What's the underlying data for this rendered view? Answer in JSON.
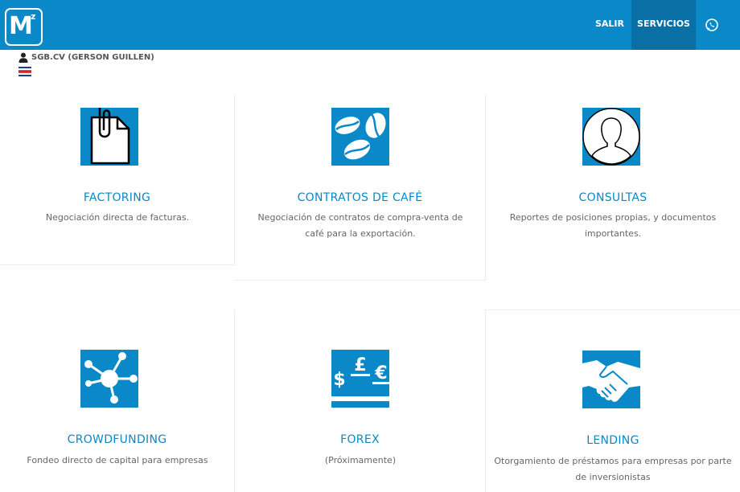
{
  "header": {
    "logo_text": "M",
    "logo_superscript": "z",
    "nav": {
      "salir": "SALIR",
      "servicios": "SERVICIOS"
    },
    "whatsapp_icon": "whatsapp-icon",
    "colors": {
      "bar": "#0a88c8",
      "active": "#0a6fa5"
    }
  },
  "user": {
    "name": "SGB.CV (GERSON GUILLEN)",
    "icon": "user-icon",
    "flag_icon": "costa-rica-flag-icon"
  },
  "services": [
    {
      "title": "FACTORING",
      "description": "Negociación directa de facturas.",
      "icon": "document-clip-icon"
    },
    {
      "title": "CONTRATOS DE CAFÉ",
      "description": "Negociación de contratos de compra-venta de café para la exportación.",
      "icon": "coffee-beans-icon"
    },
    {
      "title": "CONSULTAS",
      "description": "Reportes de posiciones propias, y documentos importantes.",
      "icon": "user-silhouette-icon"
    },
    {
      "title": "CROWDFUNDING",
      "description": "Fondeo directo de capital para empresas",
      "icon": "network-icon"
    },
    {
      "title": "FOREX",
      "description": "(Próximamente)",
      "icon": "currency-exchange-icon"
    },
    {
      "title": "LENDING",
      "description": "Otorgamiento de préstamos para empresas por parte de inversionistas",
      "icon": "handshake-icon"
    }
  ]
}
